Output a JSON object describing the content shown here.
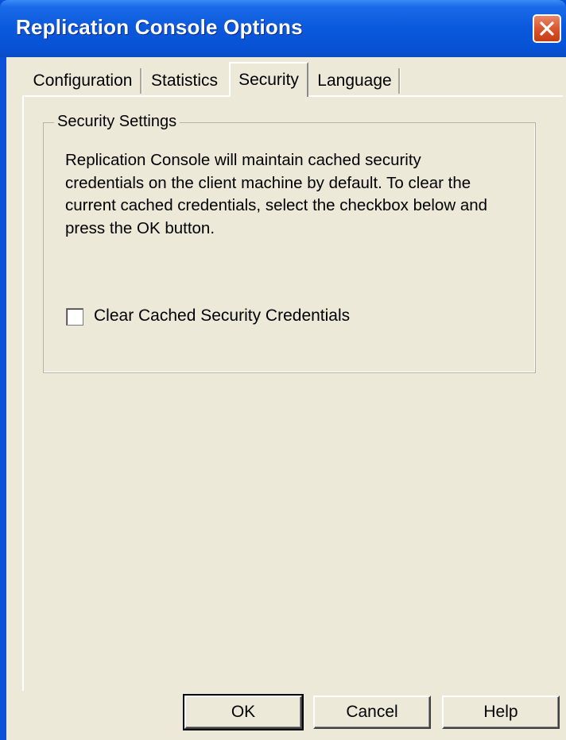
{
  "window": {
    "title": "Replication Console Options"
  },
  "tabs": [
    {
      "label": "Configuration",
      "active": false
    },
    {
      "label": "Statistics",
      "active": false
    },
    {
      "label": "Security",
      "active": true
    },
    {
      "label": "Language",
      "active": false
    }
  ],
  "security": {
    "group_label": "Security Settings",
    "description": "Replication Console will maintain cached security\ncredentials on the client machine by default.  To clear the\ncurrent cached credentials, select the checkbox below and\npress the OK button.",
    "checkbox_label": "Clear Cached Security Credentials",
    "checkbox_checked": false
  },
  "buttons": {
    "ok": "OK",
    "cancel": "Cancel",
    "help": "Help"
  },
  "colors": {
    "titlebar": "#0a58dc",
    "dialog_bg": "#ece9d8",
    "close_button": "#d9562f"
  },
  "icons": {
    "close": "close-icon"
  }
}
